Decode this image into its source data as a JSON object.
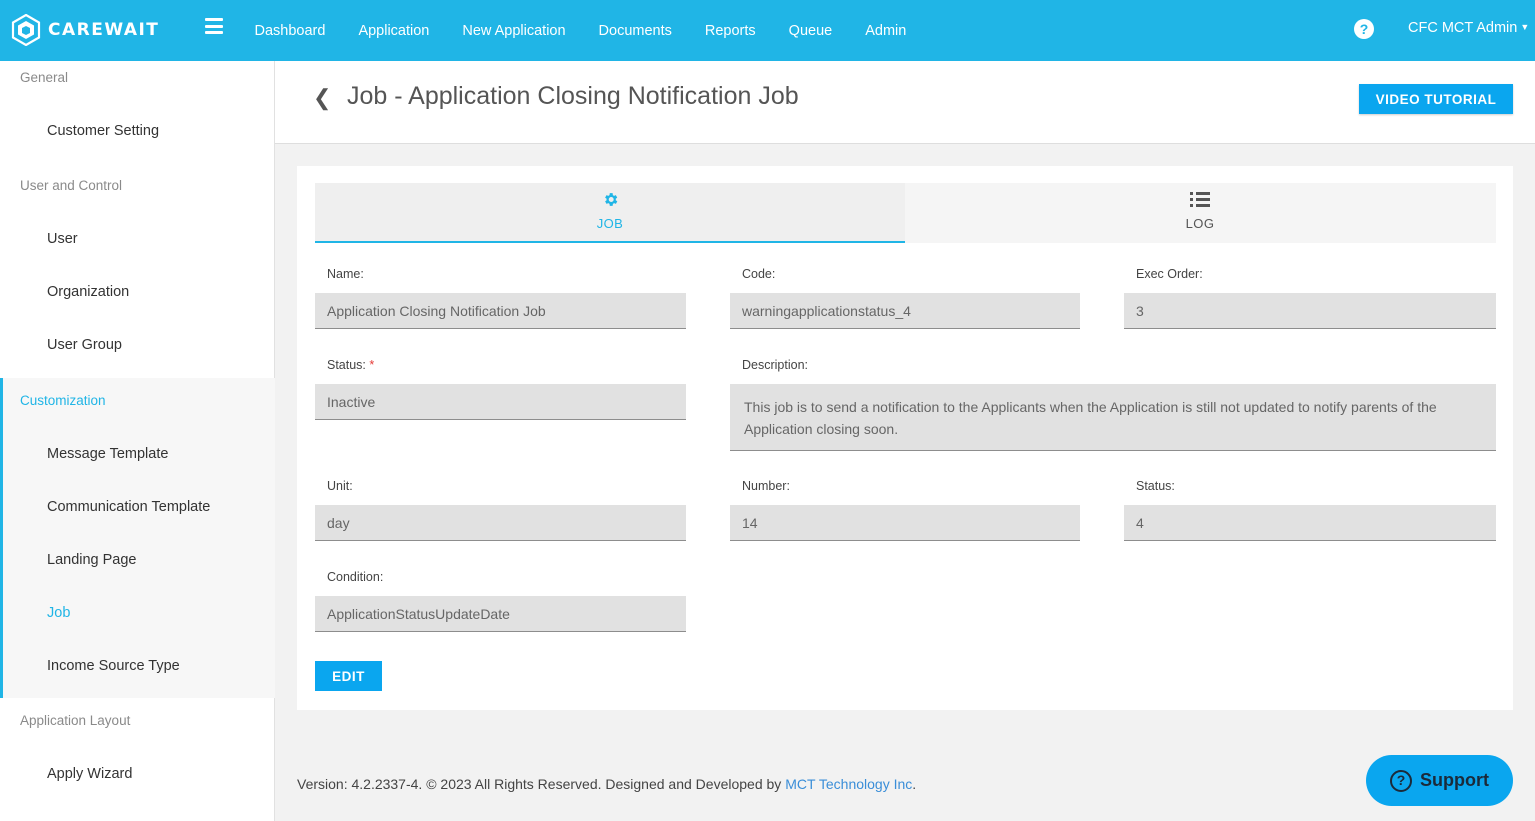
{
  "brand": {
    "name": "CAREWAIT"
  },
  "nav": {
    "items": [
      "Dashboard",
      "Application",
      "New Application",
      "Documents",
      "Reports",
      "Queue",
      "Admin"
    ],
    "user": "CFC MCT Admin",
    "help": "?"
  },
  "sidebar": {
    "groups": {
      "general": "General",
      "user_control": "User and Control",
      "customization": "Customization",
      "app_layout": "Application Layout"
    },
    "items": {
      "customer_setting": "Customer Setting",
      "user": "User",
      "organization": "Organization",
      "user_group": "User Group",
      "message_template": "Message Template",
      "communication_template": "Communication Template",
      "landing_page": "Landing Page",
      "job": "Job",
      "income_source_type": "Income Source Type",
      "apply_wizard": "Apply Wizard"
    },
    "active_item": "Job"
  },
  "page": {
    "title": "Job - Application Closing Notification Job",
    "video_button": "VIDEO TUTORIAL"
  },
  "tabs": {
    "job": "JOB",
    "log": "LOG"
  },
  "form": {
    "name": {
      "label": "Name:",
      "value": "Application Closing Notification Job"
    },
    "code": {
      "label": "Code:",
      "value": "warningapplicationstatus_4"
    },
    "exec_order": {
      "label": "Exec Order:",
      "value": "3"
    },
    "status": {
      "label": "Status:",
      "required": "*",
      "value": "Inactive"
    },
    "description": {
      "label": "Description:",
      "value": "This job is to send a notification to the Applicants when the Application is still not updated to notify parents of the Application closing soon."
    },
    "unit": {
      "label": "Unit:",
      "value": "day"
    },
    "number": {
      "label": "Number:",
      "value": "14"
    },
    "status2": {
      "label": "Status:",
      "value": "4"
    },
    "condition": {
      "label": "Condition:",
      "value": "ApplicationStatusUpdateDate"
    },
    "edit_button": "EDIT"
  },
  "footer": {
    "text": "Version: 4.2.2337-4. © 2023 All Rights Reserved. Designed and Developed by ",
    "link": "MCT Technology Inc",
    "end": "."
  },
  "support": {
    "label": "Support",
    "icon_glyph": "?"
  },
  "colors": {
    "primary": "#20b5e6",
    "button": "#0aa6ef"
  }
}
